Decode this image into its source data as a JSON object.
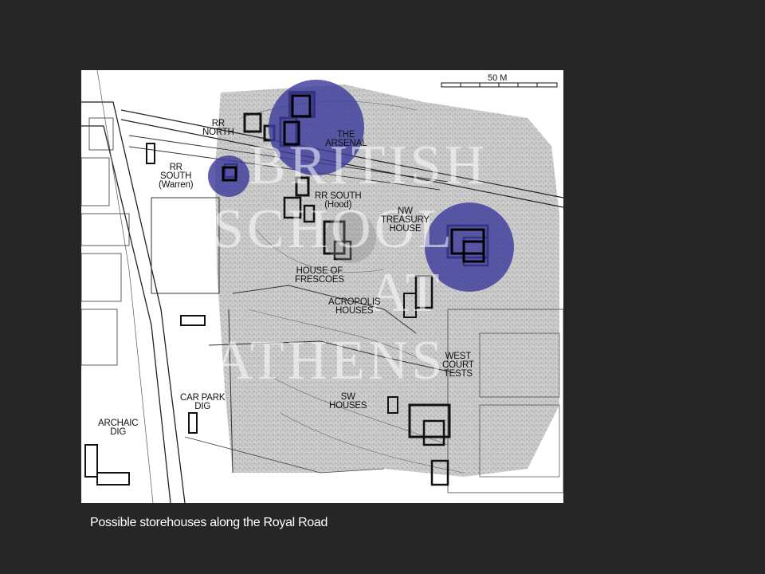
{
  "slide": {
    "caption": "Possible storehouses along the Royal Road",
    "background_color": "#262626"
  },
  "map": {
    "scale_label": "50 M",
    "highlight_color": "#3c3c9c",
    "labels": {
      "rr_north": "RR\nNORTH",
      "the_arsenal": "THE\nARSENAL",
      "rr_south_warren": "RR\nSOUTH\n(Warren)",
      "rr_south_hood": "RR SOUTH\n(Hood)",
      "nw_treasury_house": "NW\nTREASURY\nHOUSE",
      "house_of_frescoes": "HOUSE OF\nFRESCOES",
      "acropolis_houses": "ACROPOLIS\nHOUSES",
      "west_court_tests": "WEST\nCOURT\nTESTS",
      "car_park_dig": "CAR PARK\nDIG",
      "sw_houses": "SW\nHOUSES",
      "archaic_dig": "ARCHAIC\nDIG"
    },
    "watermark_lines": [
      "BRITISH",
      "SCHOOL",
      "AT",
      "ATHENS"
    ]
  }
}
